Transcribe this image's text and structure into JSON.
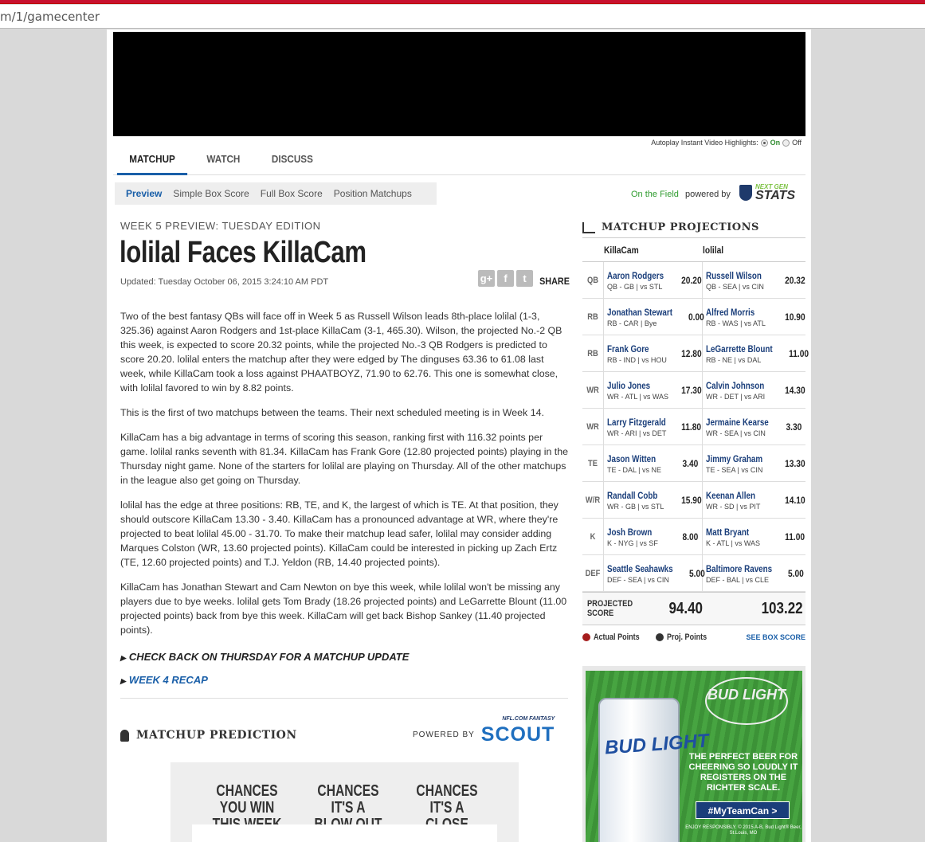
{
  "browser": {
    "url": "m/1/gamecenter"
  },
  "autoplay": {
    "label": "Autoplay Instant Video Highlights:",
    "on": "On",
    "off": "Off"
  },
  "tabs": [
    {
      "label": "MATCHUP"
    },
    {
      "label": "WATCH"
    },
    {
      "label": "DISCUSS"
    }
  ],
  "subtabs": [
    {
      "label": "Preview"
    },
    {
      "label": "Simple Box Score"
    },
    {
      "label": "Full Box Score"
    },
    {
      "label": "Position Matchups"
    }
  ],
  "onfield": {
    "link": "On the Field",
    "powered": "powered by",
    "ngs_top": "NEXT GEN",
    "ngs_main": "STATS"
  },
  "article": {
    "kicker": "WEEK 5 PREVIEW: TUESDAY EDITION",
    "headline": "lolilal Faces KillaCam",
    "updated": "Updated: Tuesday October 06, 2015 3:24:10 AM PDT",
    "share": "SHARE",
    "share_icons": [
      "g+",
      "f",
      "t"
    ],
    "paragraphs": [
      "Two of the best fantasy QBs will face off in Week 5 as Russell Wilson leads 8th-place lolilal (1-3, 325.36) against Aaron Rodgers and 1st-place KillaCam (3-1, 465.30). Wilson, the projected No.-2 QB this week, is expected to score 20.32 points, while the projected No.-3 QB Rodgers is predicted to score 20.20. lolilal enters the matchup after they were edged by The dinguses 63.36 to 61.08 last week, while KillaCam took a loss against PHAATBOYZ, 71.90 to 62.76. This one is somewhat close, with lolilal favored to win by 8.82 points.",
      "This is the first of two matchups between the teams. Their next scheduled meeting is in Week 14.",
      "KillaCam has a big advantage in terms of scoring this season, ranking first with 116.32 points per game. lolilal ranks seventh with 81.34. KillaCam has Frank Gore (12.80 projected points) playing in the Thursday night game. None of the starters for lolilal are playing on Thursday. All of the other matchups in the league also get going on Thursday.",
      "lolilal has the edge at three positions: RB, TE, and K, the largest of which is TE. At that position, they should outscore KillaCam 13.30 - 3.40. KillaCam has a pronounced advantage at WR, where they're projected to beat lolilal 45.00 - 31.70. To make their matchup lead safer, lolilal may consider adding Marques Colston (WR, 13.60 projected points). KillaCam could be interested in picking up Zach Ertz (TE, 12.60 projected points) and T.J. Yeldon (RB, 14.40 projected points).",
      "KillaCam has Jonathan Stewart and Cam Newton on bye this week, while lolilal won't be missing any players due to bye weeks. lolilal gets Tom Brady (18.26 projected points) and LeGarrette Blount (11.00 projected points) back from bye this week. KillaCam will get back Bishop Sankey (11.40 projected points)."
    ],
    "cta1": "CHECK BACK ON THURSDAY FOR A MATCHUP UPDATE",
    "cta2": "WEEK 4 RECAP"
  },
  "prediction": {
    "title": "MATCHUP PREDICTION",
    "nfl_fantasy": "NFL.COM FANTASY",
    "powered_by": "POWERED BY",
    "scout": "SCOUT",
    "chances": [
      "CHANCES YOU WIN THIS WEEK",
      "CHANCES IT'S A BLOW OUT",
      "CHANCES IT'S A CLOSE CALL"
    ]
  },
  "projections": {
    "title": "MATCHUP PROJECTIONS",
    "team1": "KillaCam",
    "team2": "lolilal",
    "rows": [
      {
        "pos": "QB",
        "p1": "Aaron Rodgers",
        "d1": "QB - GB | vs STL",
        "s1": "20.20",
        "p2": "Russell Wilson",
        "d2": "QB - SEA | vs CIN",
        "s2": "20.32"
      },
      {
        "pos": "RB",
        "p1": "Jonathan Stewart",
        "d1": "RB - CAR | Bye",
        "s1": "0.00",
        "p2": "Alfred Morris",
        "d2": "RB - WAS | vs ATL",
        "s2": "10.90"
      },
      {
        "pos": "RB",
        "p1": "Frank Gore",
        "d1": "RB - IND | vs HOU",
        "s1": "12.80",
        "p2": "LeGarrette Blount",
        "d2": "RB - NE | vs DAL",
        "s2": "11.00"
      },
      {
        "pos": "WR",
        "p1": "Julio Jones",
        "d1": "WR - ATL | vs WAS",
        "s1": "17.30",
        "p2": "Calvin Johnson",
        "d2": "WR - DET | vs ARI",
        "s2": "14.30"
      },
      {
        "pos": "WR",
        "p1": "Larry Fitzgerald",
        "d1": "WR - ARI | vs DET",
        "s1": "11.80",
        "p2": "Jermaine Kearse",
        "d2": "WR - SEA | vs CIN",
        "s2": "3.30"
      },
      {
        "pos": "TE",
        "p1": "Jason Witten",
        "d1": "TE - DAL | vs NE",
        "s1": "3.40",
        "p2": "Jimmy Graham",
        "d2": "TE - SEA | vs CIN",
        "s2": "13.30"
      },
      {
        "pos": "W/R",
        "p1": "Randall Cobb",
        "d1": "WR - GB | vs STL",
        "s1": "15.90",
        "p2": "Keenan Allen",
        "d2": "WR - SD | vs PIT",
        "s2": "14.10"
      },
      {
        "pos": "K",
        "p1": "Josh Brown",
        "d1": "K - NYG | vs SF",
        "s1": "8.00",
        "p2": "Matt Bryant",
        "d2": "K - ATL | vs WAS",
        "s2": "11.00"
      },
      {
        "pos": "DEF",
        "p1": "Seattle Seahawks",
        "d1": "DEF - SEA | vs CIN",
        "s1": "5.00",
        "p2": "Baltimore Ravens",
        "d2": "DEF - BAL | vs CLE",
        "s2": "5.00"
      }
    ],
    "score_label": "PROJECTED SCORE",
    "score1": "94.40",
    "score2": "103.22",
    "legend_actual": "Actual Points",
    "legend_proj": "Proj. Points",
    "box_link": "SEE BOX SCORE",
    "colors": {
      "actual": "#a51c1c",
      "proj": "#333333"
    }
  },
  "ad": {
    "brand": "BUD LIGHT",
    "can_text": "BUD LIGHT",
    "tagline": "THE PERFECT BEER FOR CHEERING SO LOUDLY IT REGISTERS ON THE RICHTER SCALE.",
    "button": "#MyTeamCan >",
    "fine": "ENJOY RESPONSIBLY. © 2015 A-B, Bud Light® Beer, St.Louis, MO"
  }
}
